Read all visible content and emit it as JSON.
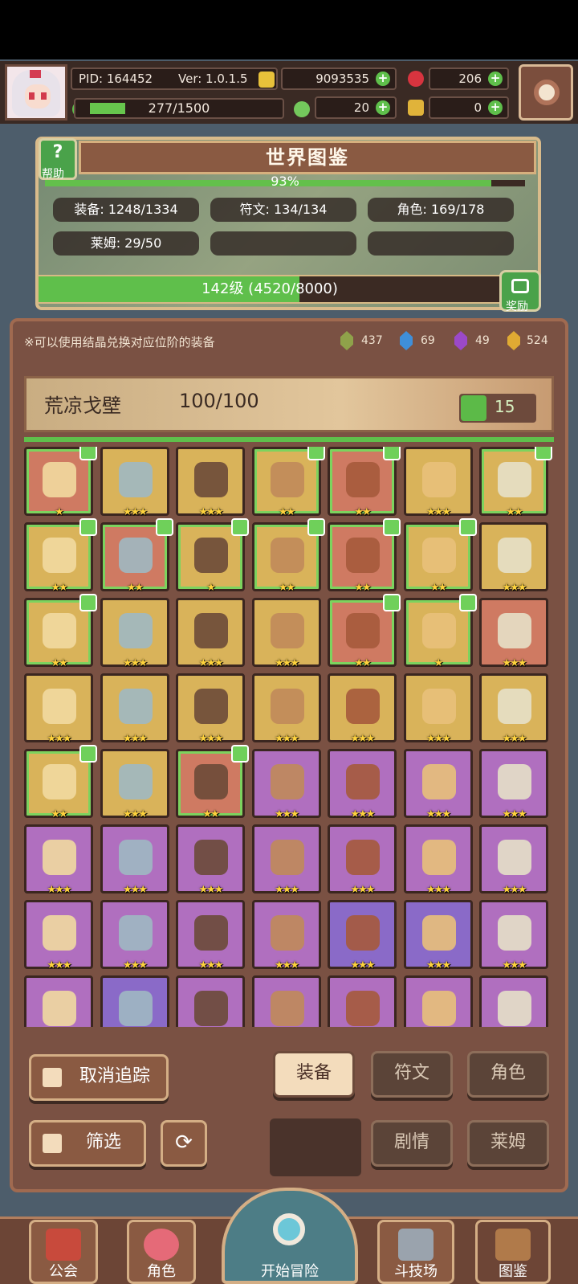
{
  "status": {
    "pid_label": "PID: 164452",
    "ver_label": "Ver: 1.0.1.5",
    "gold": "9093535",
    "gems": "206",
    "exp": "277/1500",
    "clover": "20",
    "keys": "0",
    "exp_fraction": 0.185
  },
  "atlas": {
    "title": "世界图鉴",
    "help_label": "帮助",
    "percent": "93%",
    "percent_value": 0.93,
    "stats": {
      "equipment": "装备: 1248/1334",
      "runes": "符文: 134/134",
      "characters": "角色: 169/178",
      "slimes": "莱姆: 29/50"
    },
    "level": "142级 (4520/8000)",
    "level_fraction": 0.565,
    "reward_label": "奖励"
  },
  "main": {
    "hint": "※可以使用结晶兑换对应位阶的装备",
    "crystals": [
      {
        "color": "#8fa24a",
        "value": "437"
      },
      {
        "color": "#3f8fd9",
        "value": "69"
      },
      {
        "color": "#9b49c8",
        "value": "49"
      },
      {
        "color": "#e0aa33",
        "value": "524"
      }
    ],
    "region": {
      "name": "荒凉戈壁",
      "progress": "100/100",
      "likes": "15"
    }
  },
  "items": [
    {
      "rarity": "red",
      "stars": "★",
      "tracked": true
    },
    {
      "rarity": "gold",
      "stars": "★★★",
      "tracked": false
    },
    {
      "rarity": "gold",
      "stars": "★★★",
      "tracked": false
    },
    {
      "rarity": "gold",
      "stars": "★★",
      "tracked": true
    },
    {
      "rarity": "red",
      "stars": "★★",
      "tracked": true
    },
    {
      "rarity": "gold",
      "stars": "★★★",
      "tracked": false
    },
    {
      "rarity": "gold",
      "stars": "★★",
      "tracked": true
    },
    {
      "rarity": "gold",
      "stars": "★★",
      "tracked": true
    },
    {
      "rarity": "red",
      "stars": "★★",
      "tracked": true
    },
    {
      "rarity": "gold",
      "stars": "★",
      "tracked": true
    },
    {
      "rarity": "gold",
      "stars": "★★",
      "tracked": true
    },
    {
      "rarity": "red",
      "stars": "★★",
      "tracked": true
    },
    {
      "rarity": "gold",
      "stars": "★★",
      "tracked": true
    },
    {
      "rarity": "gold",
      "stars": "★★★",
      "tracked": false
    },
    {
      "rarity": "gold",
      "stars": "★★",
      "tracked": true
    },
    {
      "rarity": "gold",
      "stars": "★★★",
      "tracked": false
    },
    {
      "rarity": "gold",
      "stars": "★★★",
      "tracked": false
    },
    {
      "rarity": "gold",
      "stars": "★★★",
      "tracked": false
    },
    {
      "rarity": "red",
      "stars": "★★",
      "tracked": true
    },
    {
      "rarity": "gold",
      "stars": "★",
      "tracked": true
    },
    {
      "rarity": "red",
      "stars": "★★★",
      "tracked": false
    },
    {
      "rarity": "gold",
      "stars": "★★★",
      "tracked": false
    },
    {
      "rarity": "gold",
      "stars": "★★★",
      "tracked": false
    },
    {
      "rarity": "gold",
      "stars": "★★★",
      "tracked": false
    },
    {
      "rarity": "gold",
      "stars": "★★★",
      "tracked": false
    },
    {
      "rarity": "gold",
      "stars": "★★★",
      "tracked": false
    },
    {
      "rarity": "gold",
      "stars": "★★★",
      "tracked": false
    },
    {
      "rarity": "gold",
      "stars": "★★★",
      "tracked": false
    },
    {
      "rarity": "gold",
      "stars": "★★",
      "tracked": true
    },
    {
      "rarity": "gold",
      "stars": "★★★",
      "tracked": false
    },
    {
      "rarity": "red",
      "stars": "★★",
      "tracked": true
    },
    {
      "rarity": "purple",
      "stars": "★★★",
      "tracked": false
    },
    {
      "rarity": "purple",
      "stars": "★★★",
      "tracked": false
    },
    {
      "rarity": "purple",
      "stars": "★★★",
      "tracked": false
    },
    {
      "rarity": "purple",
      "stars": "★★★",
      "tracked": false
    },
    {
      "rarity": "purple",
      "stars": "★★★",
      "tracked": false
    },
    {
      "rarity": "purple",
      "stars": "★★★",
      "tracked": false
    },
    {
      "rarity": "purple",
      "stars": "★★★",
      "tracked": false
    },
    {
      "rarity": "purple",
      "stars": "★★★",
      "tracked": false
    },
    {
      "rarity": "purple",
      "stars": "★★★",
      "tracked": false
    },
    {
      "rarity": "purple",
      "stars": "★★★",
      "tracked": false
    },
    {
      "rarity": "purple",
      "stars": "★★★",
      "tracked": false
    },
    {
      "rarity": "purple",
      "stars": "★★★",
      "tracked": false
    },
    {
      "rarity": "purple",
      "stars": "★★★",
      "tracked": false
    },
    {
      "rarity": "purple",
      "stars": "★★★",
      "tracked": false
    },
    {
      "rarity": "purple",
      "stars": "★★★",
      "tracked": false
    },
    {
      "rarity": "violet",
      "stars": "★★★",
      "tracked": false
    },
    {
      "rarity": "violet",
      "stars": "★★★",
      "tracked": false
    },
    {
      "rarity": "purple",
      "stars": "★★★",
      "tracked": false
    },
    {
      "rarity": "purple",
      "stars": "",
      "tracked": false
    },
    {
      "rarity": "violet",
      "stars": "",
      "tracked": false
    },
    {
      "rarity": "purple",
      "stars": "",
      "tracked": false
    },
    {
      "rarity": "purple",
      "stars": "",
      "tracked": false
    },
    {
      "rarity": "purple",
      "stars": "",
      "tracked": false
    },
    {
      "rarity": "purple",
      "stars": "",
      "tracked": false
    },
    {
      "rarity": "purple",
      "stars": "",
      "tracked": false
    }
  ],
  "controls": {
    "untrack": "取消追踪",
    "filter": "筛选",
    "tab_equipment": "装备",
    "tab_runes": "符文",
    "tab_characters": "角色",
    "tab_story": "剧情",
    "tab_slimes": "莱姆"
  },
  "nav": {
    "guild": "公会",
    "character": "角色",
    "adventure": "开始冒险",
    "arena": "斗技场",
    "atlas": "图鉴"
  },
  "colors": {
    "accent_green": "#5fbf4b",
    "panel_brown": "#7a5143",
    "gold_tile": "#d9b35a",
    "purple_tile": "#b06fbf"
  }
}
